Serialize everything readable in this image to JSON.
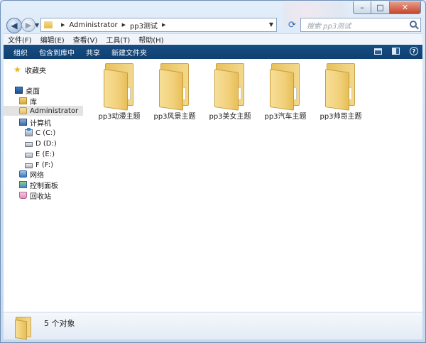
{
  "window": {
    "controls": {
      "minimize": "–",
      "maximize": "□",
      "close": "✕"
    }
  },
  "address_bar": {
    "crumbs": [
      "Administrator",
      "pp3测试"
    ],
    "search_placeholder": "搜索 pp3测试"
  },
  "menu": [
    "文件(F)",
    "编辑(E)",
    "查看(V)",
    "工具(T)",
    "帮助(H)"
  ],
  "command_bar": [
    "组织",
    "包含到库中",
    "共享",
    "新建文件夹"
  ],
  "nav_pane": {
    "favorites": "收藏夹",
    "desktop": "桌面",
    "library": "库",
    "user": "Administrator",
    "computer": "计算机",
    "drives": [
      "C (C:)",
      "D (D:)",
      "E (E:)",
      "F (F:)"
    ],
    "network": "网络",
    "control_panel": "控制面板",
    "recycle_bin": "回收站"
  },
  "files": [
    "pp3动漫主题",
    "pp3风景主题",
    "pp3美女主题",
    "pp3汽车主题",
    "pp3帅哥主题"
  ],
  "details": {
    "item_count": "5 个对象"
  },
  "colors": {
    "command_bar": "#174e85",
    "folder": "#f1d07b",
    "selected_nav": "#e3e3e3"
  },
  "icons": {
    "favorites": "star-icon",
    "desktop": "desktop-icon",
    "library": "library-icon",
    "user": "user-folder-icon",
    "computer": "computer-icon",
    "drive": "drive-icon",
    "network": "network-icon",
    "control_panel": "control-panel-icon",
    "recycle_bin": "recycle-bin-icon",
    "folder": "folder-icon"
  }
}
